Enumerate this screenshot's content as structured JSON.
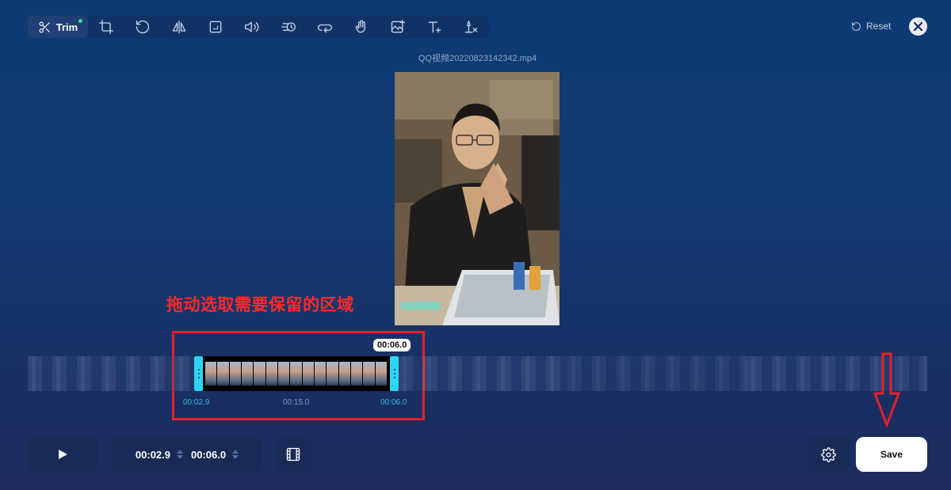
{
  "toolbar": {
    "tools": [
      {
        "name": "trim",
        "label": "Trim",
        "icon": "scissors-icon",
        "active": true
      },
      {
        "name": "crop",
        "icon": "crop-icon"
      },
      {
        "name": "rotate",
        "icon": "rotate-icon"
      },
      {
        "name": "flip",
        "icon": "flip-icon"
      },
      {
        "name": "resize",
        "icon": "resize-icon"
      },
      {
        "name": "volume",
        "icon": "volume-icon"
      },
      {
        "name": "speed",
        "icon": "speed-icon"
      },
      {
        "name": "loop",
        "icon": "loop-icon"
      },
      {
        "name": "stabilize",
        "icon": "stabilize-icon"
      },
      {
        "name": "add-image",
        "icon": "add-image-icon"
      },
      {
        "name": "add-text",
        "icon": "add-text-icon"
      },
      {
        "name": "remove-watermark",
        "icon": "remove-watermark-icon"
      }
    ]
  },
  "header": {
    "reset_label": "Reset",
    "filename": "QQ视频20220823142342.mp4"
  },
  "annotation": {
    "text": "拖动选取需要保留的区域",
    "color": "#ff2a2a"
  },
  "timeline": {
    "playhead_time": "00:06.0",
    "start_label": "00:02.9",
    "middle_label": "00:15.0",
    "end_label": "00:06.0",
    "accent_color": "#2fd4f3"
  },
  "controls": {
    "start_time": "00:02.9",
    "end_time": "00:06.0",
    "save_label": "Save"
  }
}
